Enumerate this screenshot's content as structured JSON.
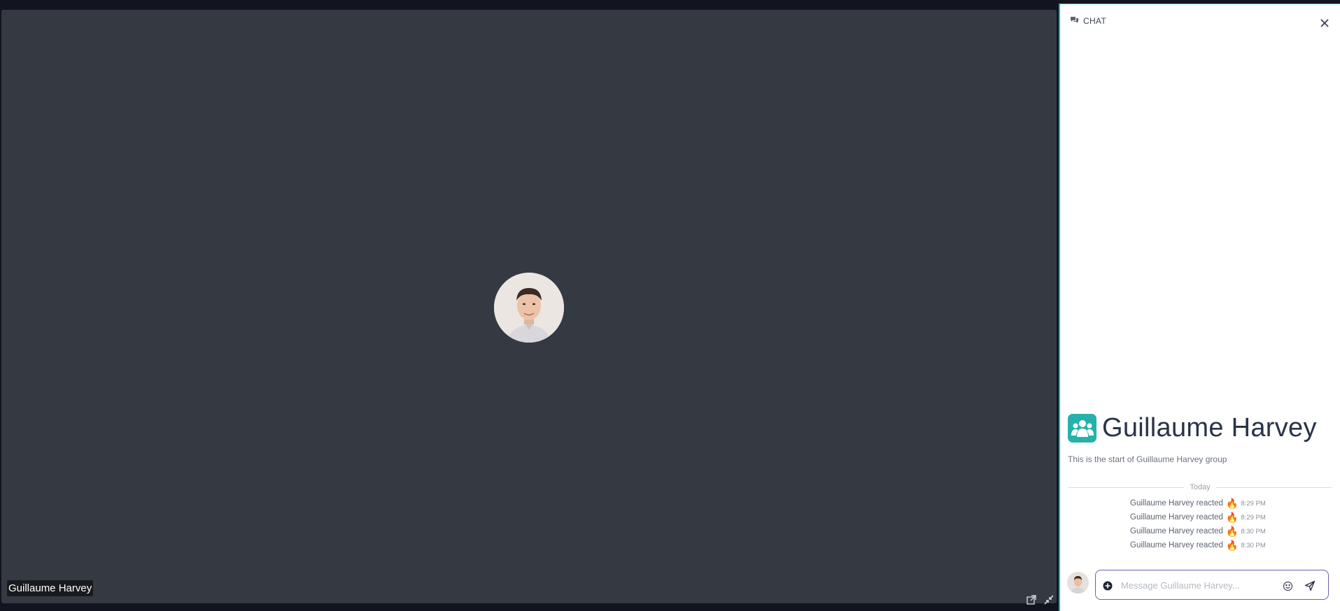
{
  "stage": {
    "participant_name": "Guillaume Harvey"
  },
  "chat": {
    "title": "CHAT",
    "group_name": "Guillaume Harvey",
    "group_subtitle": "This is the start of Guillaume Harvey group",
    "divider_label": "Today",
    "messages": [
      {
        "text": "Guillaume Harvey reacted",
        "emoji": "🔥",
        "time": "8:29 PM"
      },
      {
        "text": "Guillaume Harvey reacted",
        "emoji": "🔥",
        "time": "8:29 PM"
      },
      {
        "text": "Guillaume Harvey reacted",
        "emoji": "🔥",
        "time": "8:30 PM"
      },
      {
        "text": "Guillaume Harvey reacted",
        "emoji": "🔥",
        "time": "8:30 PM"
      }
    ],
    "composer": {
      "placeholder": "Message Guillaume Harvey..."
    }
  },
  "colors": {
    "accent": "#1bb3b8",
    "group_icon": "#26b1ad",
    "stage_bg": "#353a42",
    "composer_border": "#6b5fb5"
  },
  "icons": {
    "chat": "chat-bubbles-icon",
    "close": "close-icon",
    "group": "group-icon",
    "popout": "popout-icon",
    "minimize": "minimize-icon",
    "add": "add-circle-icon",
    "emoji": "emoji-icon",
    "send": "send-icon"
  }
}
